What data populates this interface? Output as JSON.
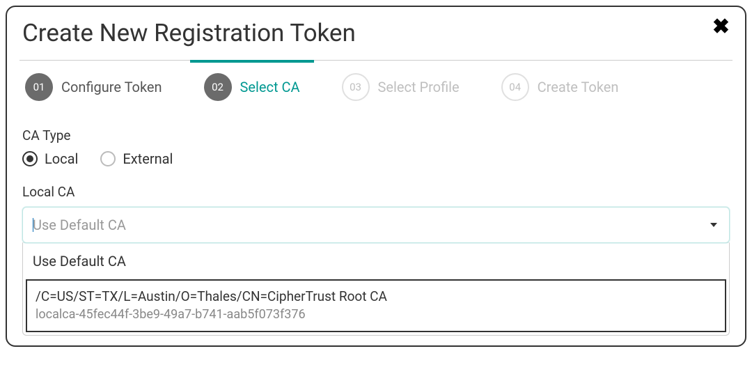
{
  "modal": {
    "title": "Create New Registration Token"
  },
  "stepper": {
    "steps": [
      {
        "num": "01",
        "label": "Configure Token",
        "state": "completed"
      },
      {
        "num": "02",
        "label": "Select CA",
        "state": "active"
      },
      {
        "num": "03",
        "label": "Select Profile",
        "state": "pending"
      },
      {
        "num": "04",
        "label": "Create Token",
        "state": "pending"
      }
    ]
  },
  "ca_type": {
    "label": "CA Type",
    "options": [
      {
        "label": "Local",
        "selected": true
      },
      {
        "label": "External",
        "selected": false
      }
    ]
  },
  "local_ca": {
    "label": "Local CA",
    "input_value": "Use Default CA",
    "dropdown": [
      {
        "type": "simple",
        "label": "Use Default CA"
      },
      {
        "type": "complex",
        "dn": "/C=US/ST=TX/L=Austin/O=Thales/CN=CipherTrust Root CA",
        "id": "localca-45fec44f-3be9-49a7-b741-aab5f073f376"
      }
    ]
  }
}
